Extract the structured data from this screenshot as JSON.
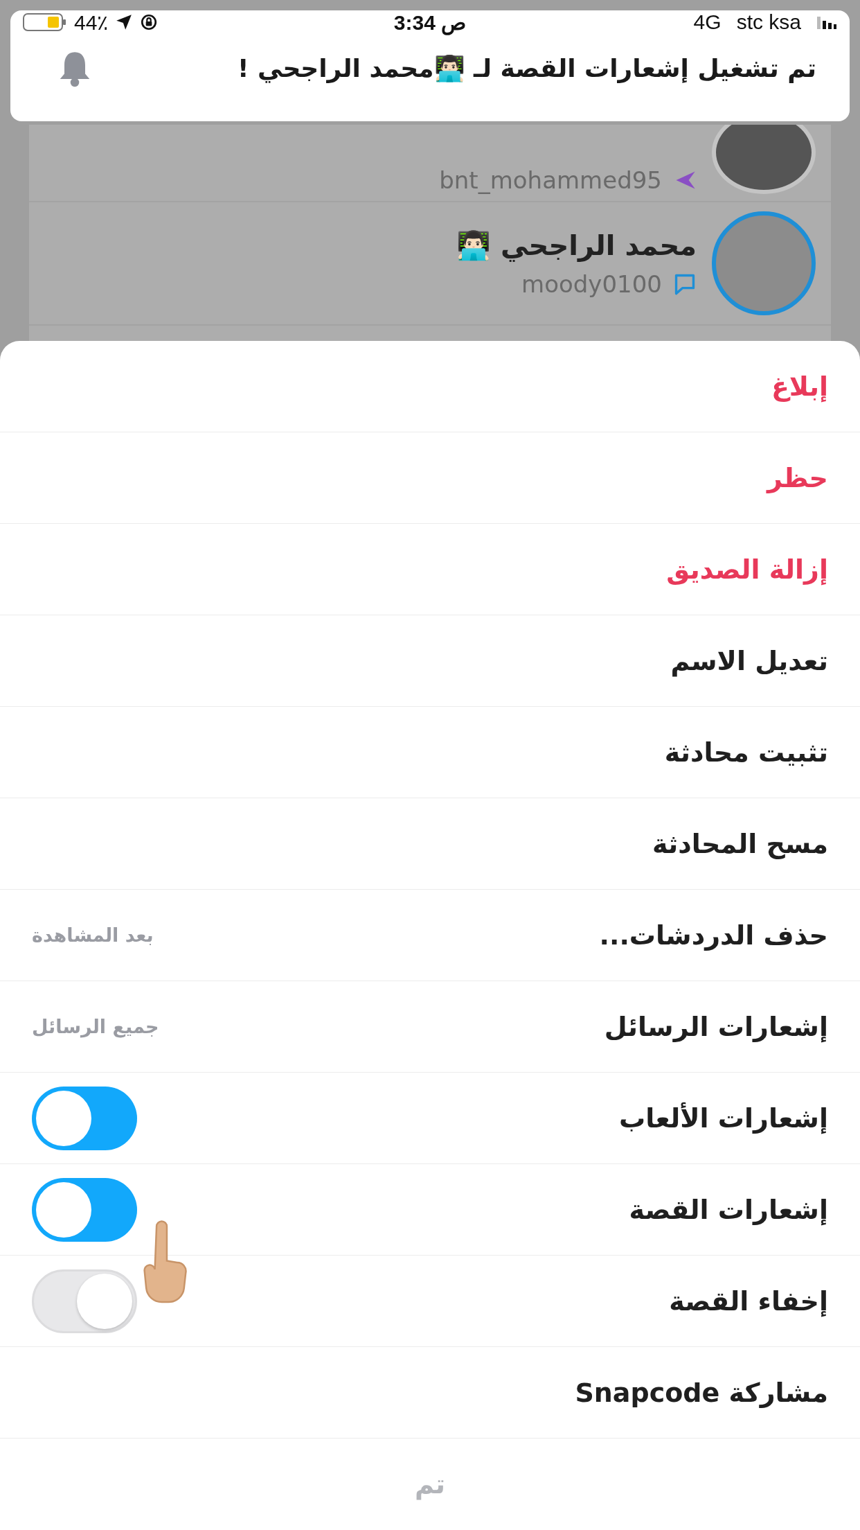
{
  "status_bar": {
    "battery": "44٪",
    "time": "3:34 ص",
    "network": "4G",
    "carrier": "stc ksa"
  },
  "notification": {
    "message": "تم تشغيل إشعارات القصة لـ 👨🏻‍💻محمد الراجحي !"
  },
  "background_list": [
    {
      "username": "bnt_mohammed95",
      "kind": "sent"
    },
    {
      "name": "محمد الراجحي 👨🏻‍💻",
      "username": "moody0100",
      "kind": "chat"
    }
  ],
  "menu": [
    {
      "label": "إبلاغ",
      "kind": "danger"
    },
    {
      "label": "حظر",
      "kind": "danger"
    },
    {
      "label": "إزالة الصديق",
      "kind": "danger"
    },
    {
      "label": "تعديل الاسم",
      "kind": "plain"
    },
    {
      "label": "تثبيت محادثة",
      "kind": "plain"
    },
    {
      "label": "مسح المحادثة",
      "kind": "plain"
    },
    {
      "label": "حذف الدردشات...",
      "kind": "value",
      "value": "بعد المشاهدة"
    },
    {
      "label": "إشعارات الرسائل",
      "kind": "value",
      "value": "جميع الرسائل"
    },
    {
      "label": "إشعارات الألعاب",
      "kind": "toggle",
      "on": true
    },
    {
      "label": "إشعارات القصة",
      "kind": "toggle",
      "on": true
    },
    {
      "label": "إخفاء القصة",
      "kind": "toggle",
      "on": false
    },
    {
      "label": "مشاركة Snapcode",
      "kind": "plain"
    }
  ],
  "done_button": "تم"
}
